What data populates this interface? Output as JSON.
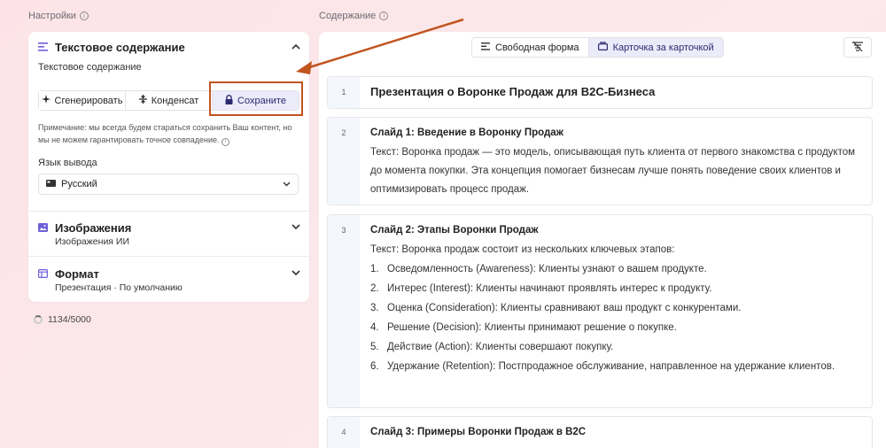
{
  "left_section_label": "Настройки",
  "right_section_label": "Содержание",
  "text_content": {
    "title": "Текстовое содержание",
    "field_label": "Текстовое содержание",
    "buttons": [
      "Сгенерировать",
      "Конденсат",
      "Сохраните"
    ],
    "active_button": "Сохраните",
    "note": "Примечание: мы всегда будем стараться сохранить Ваш контент, но мы не можем гарантировать точное совпадение.",
    "lang_label": "Язык вывода",
    "lang_value": "Русский"
  },
  "images": {
    "title": "Изображения",
    "subtitle": "Изображения ИИ"
  },
  "format": {
    "title": "Формат",
    "subtitle": "Презентация · По умолчанию"
  },
  "counter": "1134/5000",
  "view_toggle": {
    "options": [
      "Свободная форма",
      "Карточка за карточкой"
    ],
    "active": "Карточка за карточкой"
  },
  "cards": [
    {
      "num": "1",
      "title": "Презентация о Воронке Продаж для B2C-Бизнеса"
    },
    {
      "num": "2",
      "title": "Слайд 1: Введение в Воронку Продаж",
      "text": "Текст: Воронка продаж — это модель, описывающая путь клиента от первого знакомства с продуктом до момента покупки. Эта концепция помогает бизнесам лучше понять поведение своих клиентов и оптимизировать процесс продаж."
    },
    {
      "num": "3",
      "title": "Слайд 2: Этапы Воронки Продаж",
      "text": "Текст: Воронка продаж состоит из нескольких ключевых этапов:",
      "items": [
        "Осведомленность (Awareness): Клиенты узнают о вашем продукте.",
        "Интерес (Interest): Клиенты начинают проявлять интерес к продукту.",
        "Оценка (Consideration): Клиенты сравнивают ваш продукт с конкурентами.",
        "Решение (Decision): Клиенты принимают решение о покупке.",
        "Действие (Action): Клиенты совершают покупку.",
        "Удержание (Retention): Постпродажное обслуживание, направленное на удержание клиентов."
      ]
    },
    {
      "num": "4",
      "title": "Слайд 3: Примеры Воронки Продаж в B2C"
    }
  ],
  "colors": {
    "accent": "#ecebfa",
    "highlight": "#c2541e",
    "background": "#fde6ea"
  }
}
